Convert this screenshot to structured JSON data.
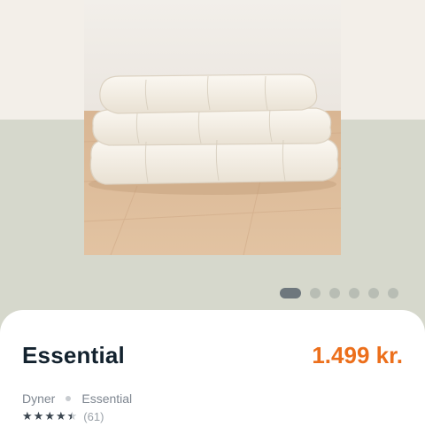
{
  "colors": {
    "background_top": "#f3efe9",
    "background_bottom": "#d6d8cc",
    "title": "#13222e",
    "price": "#ec6f1b",
    "dot_active": "#6e777d",
    "dot_inactive": "#b8bdb4"
  },
  "gallery": {
    "image_icon": "folded-duvet-photo",
    "active_index": 0,
    "dot_count": 6
  },
  "product": {
    "title": "Essential",
    "price": "1.499 kr.",
    "breadcrumb": [
      "Dyner",
      "Essential"
    ],
    "rating": 4.5,
    "rating_max": 5,
    "review_count": "(61)"
  }
}
